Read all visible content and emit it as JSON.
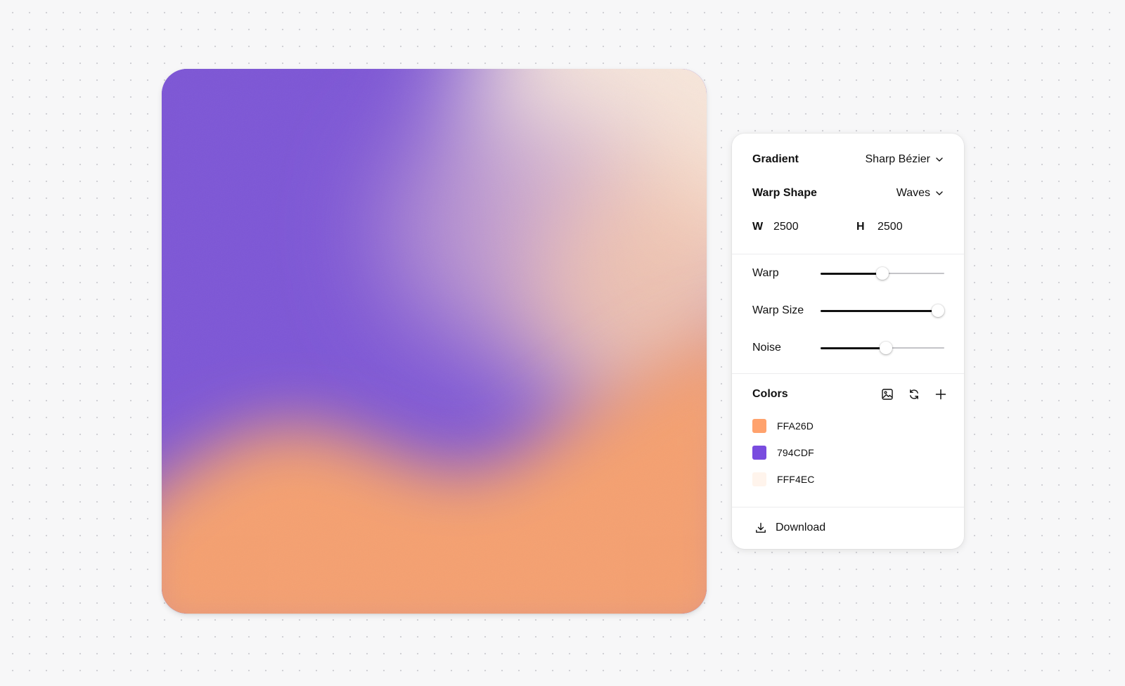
{
  "panel": {
    "gradient": {
      "label": "Gradient",
      "value": "Sharp Bézier"
    },
    "warp_shape": {
      "label": "Warp Shape",
      "value": "Waves"
    },
    "dimensions": {
      "width_label": "W",
      "width_value": "2500",
      "height_label": "H",
      "height_value": "2500"
    },
    "sliders": [
      {
        "label": "Warp",
        "value": 0.5
      },
      {
        "label": "Warp Size",
        "value": 0.95
      },
      {
        "label": "Noise",
        "value": 0.53
      }
    ],
    "colors": {
      "title": "Colors",
      "icons": [
        "image-icon",
        "refresh-icon",
        "plus-icon"
      ],
      "items": [
        {
          "hex": "FFA26D",
          "color": "#FFA26D"
        },
        {
          "hex": "794CDF",
          "color": "#794CDF"
        },
        {
          "hex": "FFF4EC",
          "color": "#FFF4EC"
        }
      ]
    },
    "download": {
      "label": "Download",
      "icon": "download-icon"
    }
  },
  "preview": {
    "colors": {
      "orange": "#F5A070",
      "purple": "#7D56D6",
      "cream": "#F8E7DB"
    }
  }
}
